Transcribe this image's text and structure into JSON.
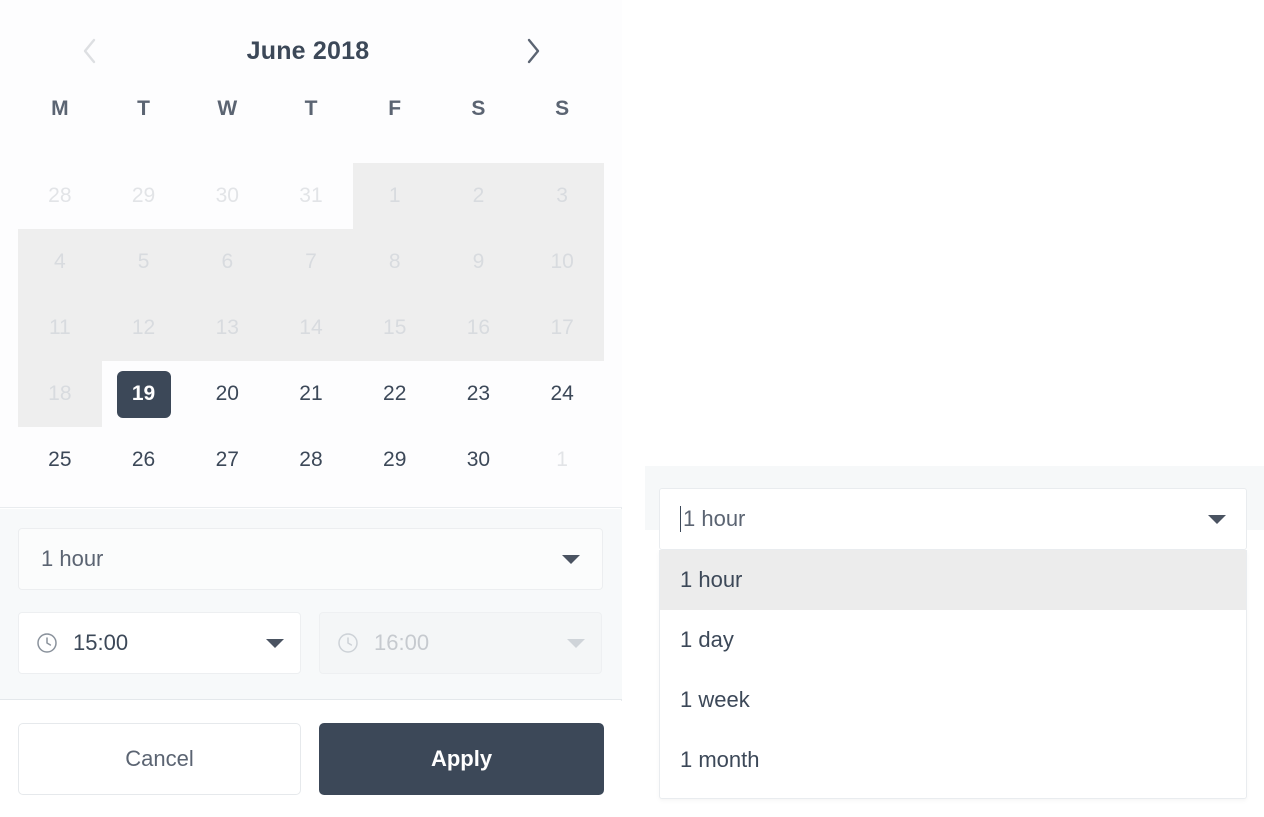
{
  "calendar": {
    "prev_icon": "chevron-left-icon",
    "next_icon": "chevron-right-icon",
    "title": "June 2018",
    "weekdays": [
      "M",
      "T",
      "W",
      "T",
      "F",
      "S",
      "S"
    ],
    "weeks": [
      [
        {
          "label": "28",
          "state": "othermonth"
        },
        {
          "label": "29",
          "state": "othermonth"
        },
        {
          "label": "30",
          "state": "othermonth"
        },
        {
          "label": "31",
          "state": "othermonth"
        },
        {
          "label": "1",
          "state": "disabled"
        },
        {
          "label": "2",
          "state": "disabled"
        },
        {
          "label": "3",
          "state": "disabled"
        }
      ],
      [
        {
          "label": "4",
          "state": "disabled"
        },
        {
          "label": "5",
          "state": "disabled"
        },
        {
          "label": "6",
          "state": "disabled"
        },
        {
          "label": "7",
          "state": "disabled"
        },
        {
          "label": "8",
          "state": "disabled"
        },
        {
          "label": "9",
          "state": "disabled"
        },
        {
          "label": "10",
          "state": "disabled"
        }
      ],
      [
        {
          "label": "11",
          "state": "disabled"
        },
        {
          "label": "12",
          "state": "disabled"
        },
        {
          "label": "13",
          "state": "disabled"
        },
        {
          "label": "14",
          "state": "disabled"
        },
        {
          "label": "15",
          "state": "disabled"
        },
        {
          "label": "16",
          "state": "disabled"
        },
        {
          "label": "17",
          "state": "disabled"
        }
      ],
      [
        {
          "label": "18",
          "state": "disabled"
        },
        {
          "label": "19",
          "state": "selected"
        },
        {
          "label": "20",
          "state": "enabled"
        },
        {
          "label": "21",
          "state": "enabled"
        },
        {
          "label": "22",
          "state": "enabled"
        },
        {
          "label": "23",
          "state": "enabled"
        },
        {
          "label": "24",
          "state": "enabled"
        }
      ],
      [
        {
          "label": "25",
          "state": "enabled"
        },
        {
          "label": "26",
          "state": "enabled"
        },
        {
          "label": "27",
          "state": "enabled"
        },
        {
          "label": "28",
          "state": "enabled"
        },
        {
          "label": "29",
          "state": "enabled"
        },
        {
          "label": "30",
          "state": "enabled"
        },
        {
          "label": "1",
          "state": "othermonth"
        }
      ]
    ]
  },
  "controls": {
    "duration": {
      "value": "1 hour",
      "caret_icon": "chevron-down-icon"
    },
    "start_time": {
      "icon": "clock-icon",
      "value": "15:00",
      "caret_icon": "chevron-down-icon",
      "disabled": false
    },
    "end_time": {
      "icon": "clock-icon",
      "value": "16:00",
      "caret_icon": "chevron-down-icon",
      "disabled": true
    }
  },
  "footer": {
    "cancel_label": "Cancel",
    "apply_label": "Apply"
  },
  "combobox": {
    "value": "1 hour",
    "caret_icon": "chevron-down-icon",
    "options": [
      {
        "label": "1 hour",
        "highlighted": true
      },
      {
        "label": "1 day",
        "highlighted": false
      },
      {
        "label": "1 week",
        "highlighted": false
      },
      {
        "label": "1 month",
        "highlighted": false
      }
    ]
  },
  "colors": {
    "accent": "#3c4858",
    "panel_bg": "#ffffff",
    "control_bg": "#f7f9fa",
    "range_bg": "#eeeeee",
    "highlight_bg": "#ececec",
    "muted_text": "#d8dbdf"
  }
}
